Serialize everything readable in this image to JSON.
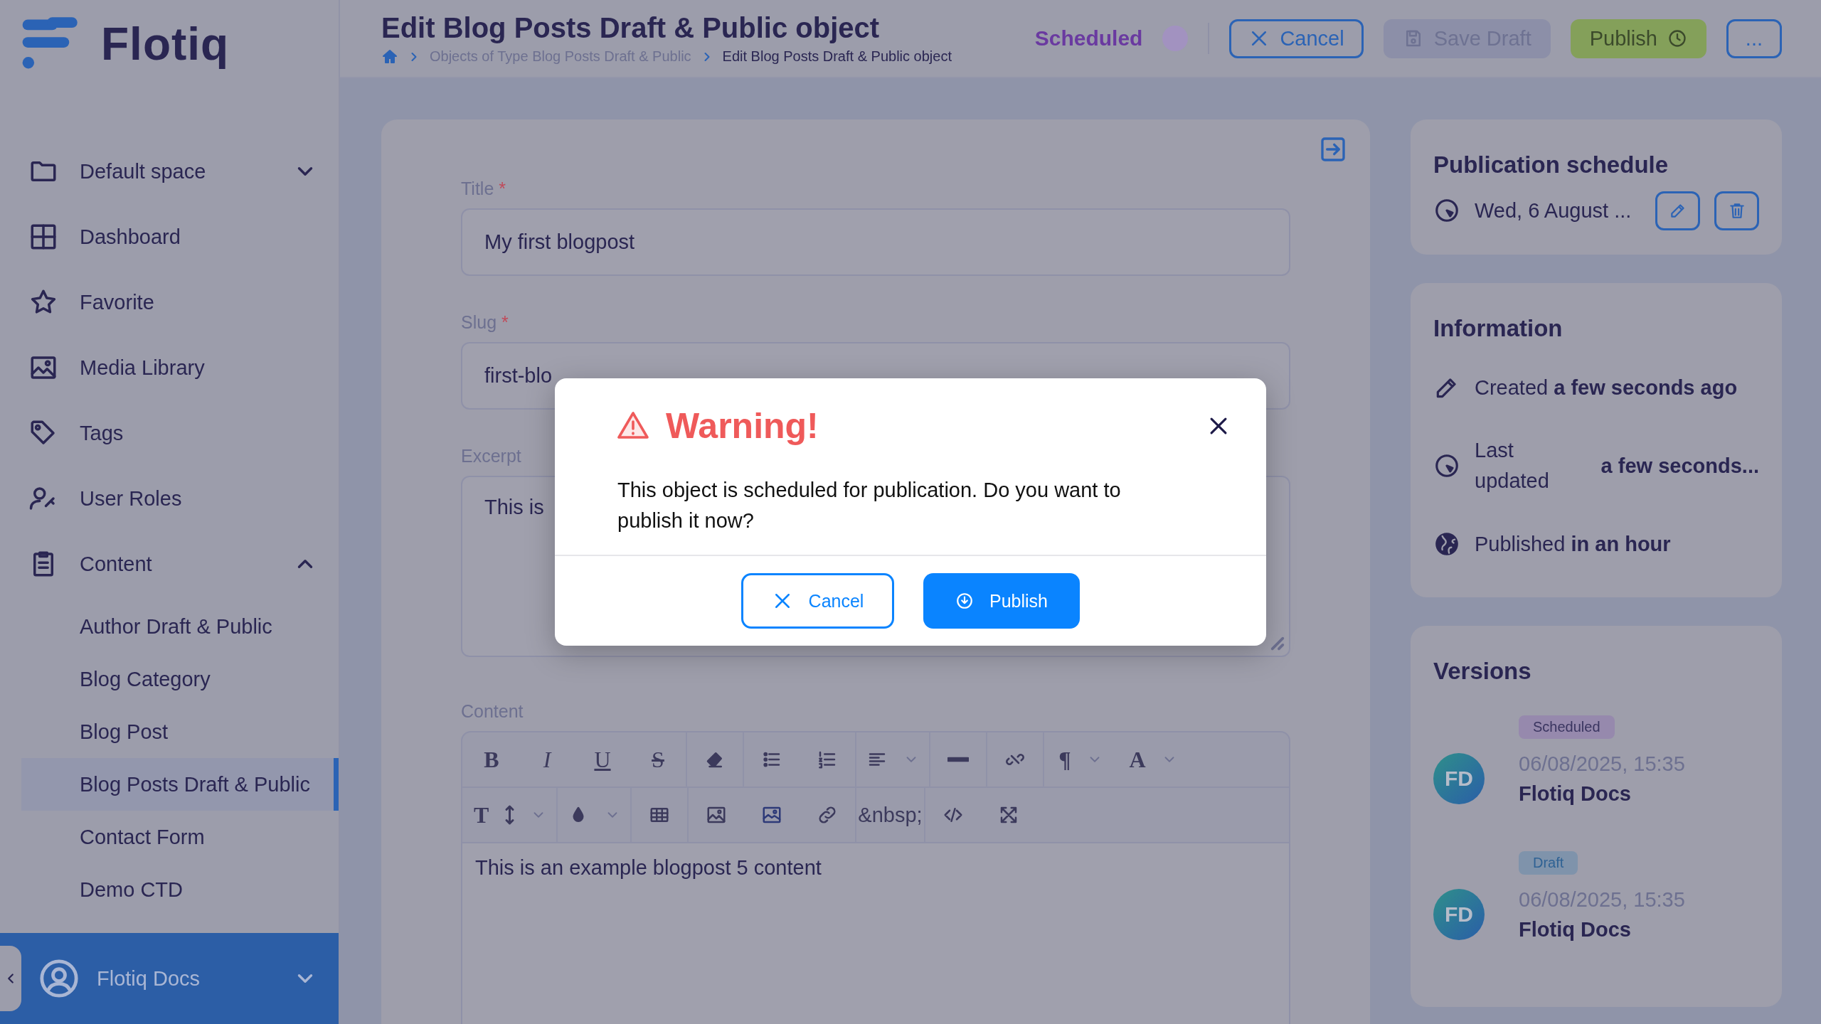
{
  "sidebar": {
    "logo": "Flotiq",
    "space": {
      "label": "Default space",
      "expanded": false
    },
    "items": [
      {
        "kind": "dashboard",
        "label": "Dashboard"
      },
      {
        "kind": "favorite",
        "label": "Favorite"
      },
      {
        "kind": "media",
        "label": "Media Library"
      },
      {
        "kind": "tags",
        "label": "Tags"
      },
      {
        "kind": "roles",
        "label": "User Roles"
      }
    ],
    "content": {
      "label": "Content",
      "expanded": true,
      "items": [
        {
          "label": "Author Draft & Public",
          "selected": false
        },
        {
          "label": "Blog Category",
          "selected": false
        },
        {
          "label": "Blog Post",
          "selected": false
        },
        {
          "label": "Blog Posts Draft & Public",
          "selected": true
        },
        {
          "label": "Contact Form",
          "selected": false
        },
        {
          "label": "Demo CTD",
          "selected": false
        }
      ]
    },
    "user": {
      "name": "Flotiq Docs"
    }
  },
  "header": {
    "title": "Edit Blog Posts Draft & Public object",
    "breadcrumbs": [
      "Objects of Type Blog Posts Draft & Public",
      "Edit Blog Posts Draft & Public object"
    ],
    "status": "Scheduled",
    "buttons": [
      {
        "kind": "cancel",
        "label": "Cancel",
        "disabled": false
      },
      {
        "kind": "save",
        "label": "Save Draft",
        "disabled": true
      },
      {
        "kind": "publish",
        "label": "Publish",
        "disabled": false
      },
      {
        "kind": "more",
        "label": "...",
        "disabled": false
      }
    ]
  },
  "form": {
    "fields": [
      {
        "kind": "input",
        "label": "Title",
        "required_mark": "*",
        "value": "My first blogpost"
      },
      {
        "kind": "input",
        "label": "Slug",
        "required_mark": "*",
        "value": "first-blo"
      },
      {
        "kind": "textarea",
        "label": "Excerpt",
        "value": "This is"
      },
      {
        "kind": "editor",
        "label": "Content",
        "value": "This is an example blogpost 5 content"
      }
    ],
    "toolbar": [
      [
        [
          {
            "kind": "bold",
            "text": "B",
            "dropdown": false
          },
          {
            "kind": "italic",
            "text": "I",
            "dropdown": false
          },
          {
            "kind": "underline",
            "text": "U",
            "dropdown": false
          },
          {
            "kind": "strike",
            "text": "S",
            "dropdown": false
          }
        ],
        [
          {
            "kind": "eraser",
            "dropdown": false
          }
        ],
        [
          {
            "kind": "bullets",
            "dropdown": false
          },
          {
            "kind": "numbers",
            "dropdown": false
          }
        ],
        [
          {
            "kind": "align",
            "dropdown": true
          }
        ],
        [
          {
            "kind": "rule",
            "dropdown": false
          }
        ],
        [
          {
            "kind": "unlink",
            "dropdown": false
          }
        ],
        [
          {
            "kind": "paragraph",
            "text": "¶",
            "dropdown": true
          },
          {
            "kind": "font",
            "text": "A",
            "dropdown": true
          }
        ]
      ],
      [
        [
          {
            "kind": "textsize",
            "text": "T",
            "dropdown": true
          }
        ],
        [
          {
            "kind": "color",
            "dropdown": true
          }
        ],
        [
          {
            "kind": "table",
            "dropdown": false
          }
        ],
        [
          {
            "kind": "image",
            "dropdown": false
          },
          {
            "kind": "gallery",
            "dropdown": false
          },
          {
            "kind": "link",
            "dropdown": false
          }
        ],
        [
          {
            "kind": "nbsp",
            "text": "&nbsp;",
            "dropdown": false
          }
        ],
        [
          {
            "kind": "code",
            "dropdown": false
          },
          {
            "kind": "expand",
            "dropdown": false
          }
        ]
      ]
    ]
  },
  "panel": {
    "schedule": {
      "title": "Publication schedule",
      "date": "Wed, 6 August ..."
    },
    "information": {
      "title": "Information",
      "rows": [
        {
          "kind": "created",
          "text": "Created **a few seconds ago**"
        },
        {
          "kind": "updated",
          "label": "Last updated",
          "value": "a few seconds..."
        },
        {
          "kind": "published",
          "text": "Published **in an hour**"
        }
      ]
    },
    "versions": {
      "title": "Versions",
      "items": [
        {
          "kind": "scheduled",
          "status": "Scheduled",
          "color": "#9689ad",
          "initials": "FD",
          "date": "06/08/2025, 15:35",
          "author": "Flotiq Docs"
        },
        {
          "kind": "draft",
          "status": "Draft",
          "color": "#7f93ab",
          "initials": "FD",
          "date": "06/08/2025, 15:35",
          "author": "Flotiq Docs"
        }
      ]
    }
  },
  "modal": {
    "title": "Warning!",
    "message": "This object is scheduled for publication. Do you want to publish it now?",
    "buttons": [
      {
        "kind": "cancel",
        "label": "Cancel"
      },
      {
        "kind": "publish",
        "label": "Publish"
      }
    ]
  }
}
